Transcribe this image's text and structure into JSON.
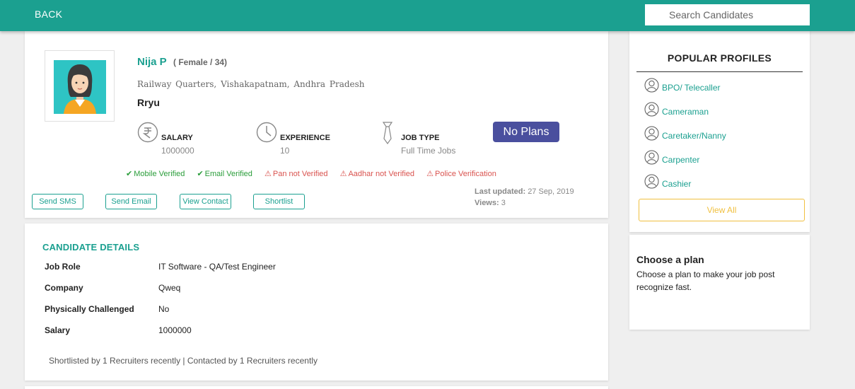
{
  "header": {
    "back_label": "BACK",
    "search_placeholder": "Search Candidates"
  },
  "candidate": {
    "name": "Nija P",
    "gender_age": "( Female / 34)",
    "address": "Railway Quarters, Vishakapatnam, Andhra Pradesh",
    "company": "Rryu",
    "stats": {
      "salary": {
        "label": "SALARY",
        "value": "1000000",
        "icon": "rupee-icon"
      },
      "experience": {
        "label": "EXPERIENCE",
        "value": "10",
        "icon": "clock-icon"
      },
      "job_type": {
        "label": "JOB TYPE",
        "value": "Full Time Jobs",
        "icon": "tie-icon"
      }
    },
    "plan_badge": "No Plans",
    "verifications": [
      {
        "label": "Mobile Verified",
        "status": "ok"
      },
      {
        "label": "Email Verified",
        "status": "ok"
      },
      {
        "label": "Pan not Verified",
        "status": "warn"
      },
      {
        "label": "Aadhar not Verified",
        "status": "warn"
      },
      {
        "label": "Police Verification",
        "status": "warn"
      }
    ],
    "actions": {
      "sms": "Send SMS",
      "email": "Send Email",
      "contact": "View Contact",
      "shortlist": "Shortlist"
    },
    "meta": {
      "last_updated_label": "Last updated:",
      "last_updated_value": "27 Sep, 2019",
      "views_label": "Views:",
      "views_value": "3"
    }
  },
  "details": {
    "title": "CANDIDATE DETAILS",
    "rows": [
      {
        "label": "Job Role",
        "value": "IT Software - QA/Test Engineer"
      },
      {
        "label": "Company",
        "value": "Qweq"
      },
      {
        "label": "Physically Challenged",
        "value": "No"
      },
      {
        "label": "Salary",
        "value": "1000000"
      }
    ],
    "recruiter_note": "Shortlisted by 1 Recruiters recently | Contacted by 1 Recruiters recently"
  },
  "popular": {
    "title": "POPULAR PROFILES",
    "items": [
      {
        "label": "BPO/ Telecaller"
      },
      {
        "label": "Cameraman"
      },
      {
        "label": "Caretaker/Nanny"
      },
      {
        "label": "Carpenter"
      },
      {
        "label": "Cashier"
      }
    ],
    "view_all": "View All"
  },
  "plan": {
    "title": "Choose a plan",
    "description": "Choose a plan to make your job post recognize fast."
  },
  "colors": {
    "brand": "#1ba090",
    "plan_badge": "#4a4f9e",
    "ok": "#2a9d3a",
    "warn": "#d9534f",
    "view_all": "#f0c040"
  }
}
